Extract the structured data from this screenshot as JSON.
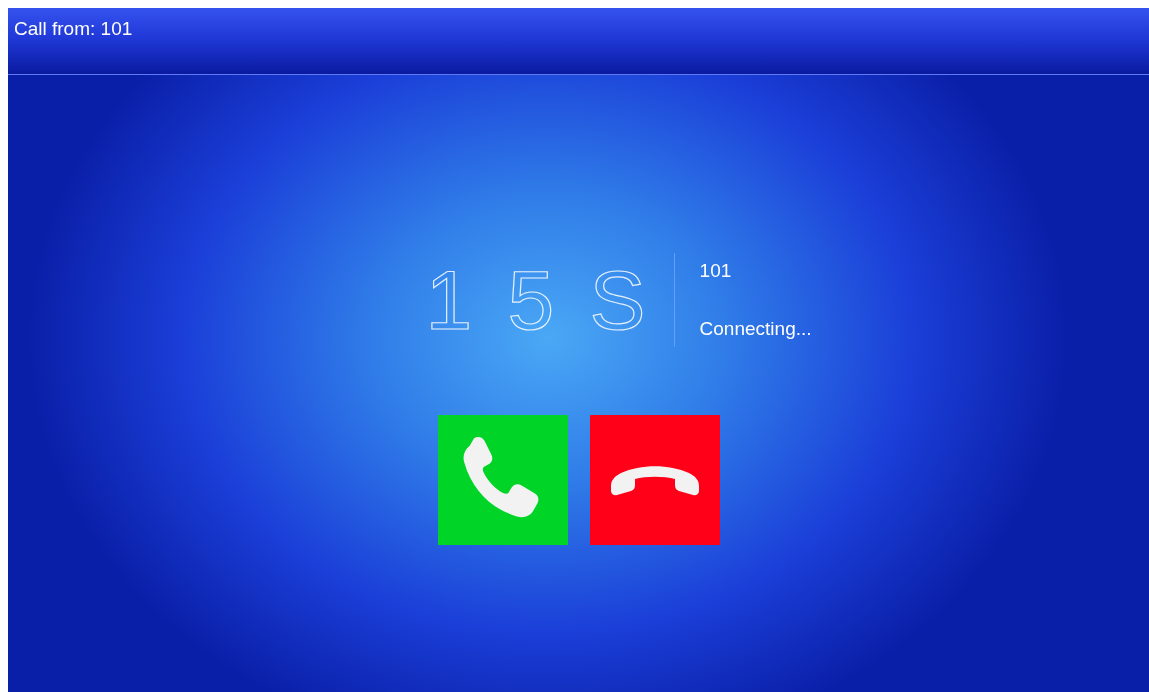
{
  "header": {
    "title": "Call from: 101"
  },
  "call": {
    "timer": "1 5 S",
    "caller": "101",
    "status": "Connecting..."
  },
  "buttons": [
    {
      "kind": "accept"
    },
    {
      "kind": "reject"
    }
  ]
}
